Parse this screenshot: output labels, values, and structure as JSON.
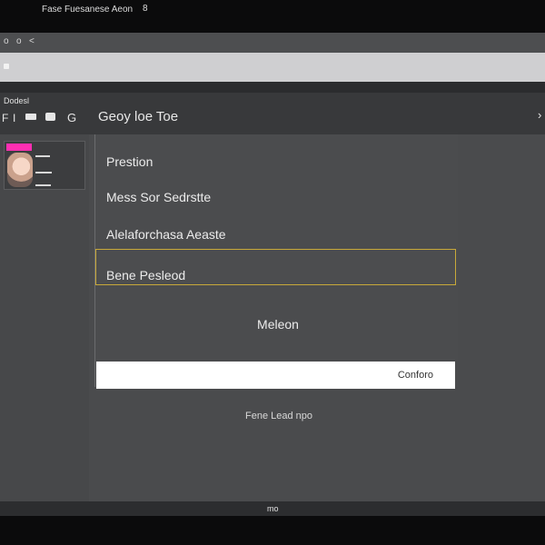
{
  "window": {
    "title": "Fase Fuesanese Aeon",
    "title_end_glyph": "8",
    "controls": [
      "o",
      "o",
      "<"
    ]
  },
  "sidebar": {
    "label": "Dodesl",
    "toolbar_glyphs": [
      "F",
      "I",
      "▬",
      "▬",
      "G"
    ]
  },
  "header": {
    "title": "Geoy loe Toe",
    "more_glyph": "›"
  },
  "card": {
    "tag_color": "#ff2fb2"
  },
  "menu": {
    "items": [
      "Prestion",
      "Mess Sor Sedrstte",
      "Alelaforchasa Aeaste",
      "Bene Pesleod"
    ],
    "selected_index": 3,
    "highlight_color": "#c8a93a"
  },
  "center_label": "Meleon",
  "confirm": {
    "label": "Conforo"
  },
  "footer_link": "Fene Lead npo",
  "bottom_text": "mo"
}
